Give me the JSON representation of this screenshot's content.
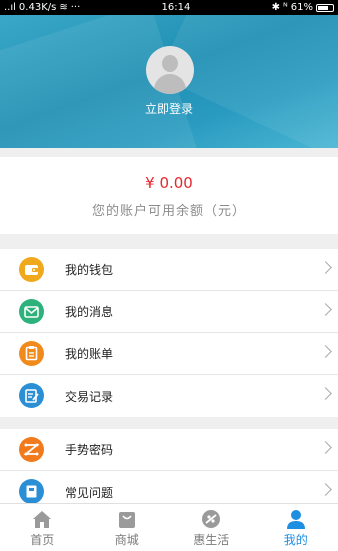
{
  "status_bar": {
    "signal": "..ıl",
    "network_speed": "0.43K/s",
    "more": "···",
    "time": "16:14",
    "right_icons": "∗ ⁿ⁄ₗ",
    "battery_percent": "61%"
  },
  "header": {
    "login_label": "立即登录"
  },
  "balance": {
    "amount": "¥ 0.00",
    "description": "您的账户可用余额（元）"
  },
  "menu_group_1": [
    {
      "label": "我的钱包",
      "icon": "wallet-icon",
      "color": "#f0a81c"
    },
    {
      "label": "我的消息",
      "icon": "message-icon",
      "color": "#2cb27a"
    },
    {
      "label": "我的账单",
      "icon": "bill-icon",
      "color": "#f08a1c"
    },
    {
      "label": "交易记录",
      "icon": "transaction-record-icon",
      "color": "#2b8fd6"
    }
  ],
  "menu_group_2": [
    {
      "label": "手势密码",
      "icon": "gesture-password-icon",
      "color": "#f07a1c"
    },
    {
      "label": "常见问题",
      "icon": "faq-icon",
      "color": "#2b8fd6"
    }
  ],
  "tab_bar": {
    "tabs": [
      {
        "label": "首页",
        "icon": "home-icon"
      },
      {
        "label": "商城",
        "icon": "mall-icon"
      },
      {
        "label": "惠生活",
        "icon": "life-icon"
      },
      {
        "label": "我的",
        "icon": "profile-icon",
        "active": true
      }
    ],
    "active_color": "#1e8ee0"
  }
}
